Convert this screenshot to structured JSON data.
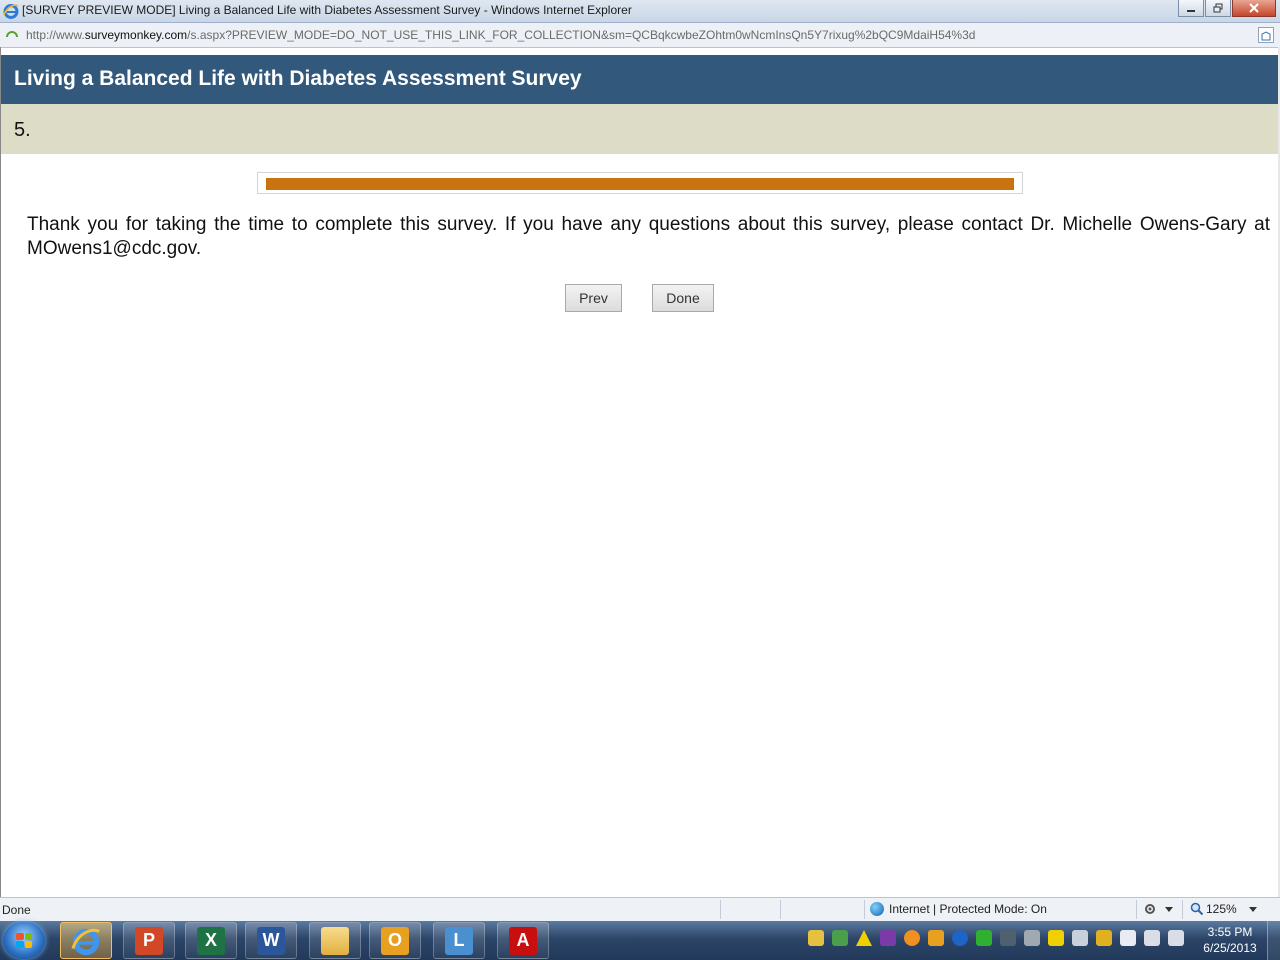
{
  "window": {
    "title": "[SURVEY PREVIEW MODE] Living a Balanced Life with Diabetes Assessment Survey - Windows Internet Explorer",
    "minimize_icon": "minimize-icon",
    "restore_icon": "restore-icon",
    "close_icon": "close-icon"
  },
  "address": {
    "url_prefix": "http://www.",
    "url_domain": "surveymonkey.com",
    "url_rest": "/s.aspx?PREVIEW_MODE=DO_NOT_USE_THIS_LINK_FOR_COLLECTION&sm=QCBqkcwbeZOhtm0wNcmInsQn5Y7rixug%2bQC9MdaiH54%3d"
  },
  "survey": {
    "title": "Living a Balanced Life with Diabetes Assessment Survey",
    "page_number": "5.",
    "progress": 1.0,
    "progress_color": "#c87212",
    "header_color": "#32587c",
    "band_color": "#dcdcc7",
    "thank_you": "Thank you for taking the time to complete this survey. If you have any questions about this survey, please contact Dr. Michelle Owens-Gary at MOwens1@cdc.gov.",
    "prev_label": "Prev",
    "done_label": "Done"
  },
  "statusbar": {
    "status": "Done",
    "zone": "Internet | Protected Mode: On",
    "zoom": "125%"
  },
  "taskbar": {
    "apps": [
      "internet-explorer",
      "powerpoint",
      "excel",
      "word",
      "file-explorer",
      "outlook",
      "lync",
      "adobe-reader"
    ],
    "time": "3:55 PM",
    "date": "6/25/2013"
  }
}
